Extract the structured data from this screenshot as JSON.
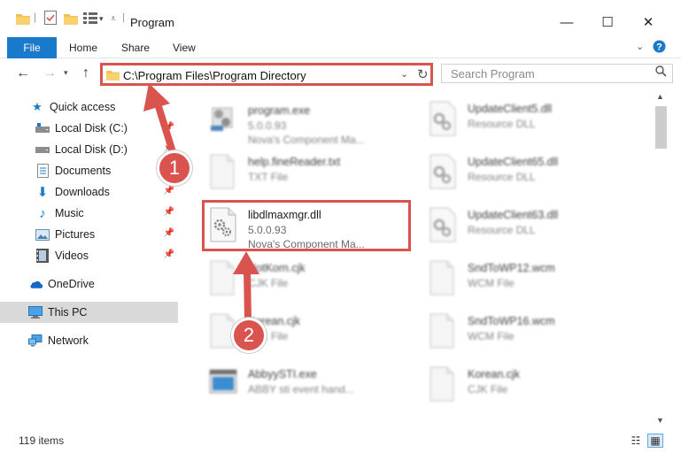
{
  "window": {
    "title": "Program",
    "controls": {
      "minimize": "—",
      "maximize": "☐",
      "close": "✕"
    }
  },
  "ribbon": {
    "tabs": [
      {
        "label": "File",
        "active": true
      },
      {
        "label": "Home"
      },
      {
        "label": "Share"
      },
      {
        "label": "View"
      }
    ],
    "collapse_icon": "chevron-down-icon",
    "help_icon": "help-icon"
  },
  "address_bar": {
    "path": "C:\\Program Files\\Program Directory",
    "search_placeholder": "Search Program"
  },
  "nav_pane": {
    "items": [
      {
        "label": "Quick access",
        "icon": "star-icon",
        "pinned": false
      },
      {
        "label": "Local Disk (C:)",
        "icon": "drive-icon",
        "pinned": true
      },
      {
        "label": "Local Disk (D:)",
        "icon": "drive-icon",
        "pinned": true
      },
      {
        "label": "Documents",
        "icon": "documents-icon",
        "pinned": true
      },
      {
        "label": "Downloads",
        "icon": "downloads-icon",
        "pinned": true
      },
      {
        "label": "Music",
        "icon": "music-icon",
        "pinned": true
      },
      {
        "label": "Pictures",
        "icon": "pictures-icon",
        "pinned": true
      },
      {
        "label": "Videos",
        "icon": "videos-icon",
        "pinned": true
      },
      {
        "label": "OneDrive",
        "icon": "onedrive-icon",
        "pinned": false
      },
      {
        "label": "This PC",
        "icon": "this-pc-icon",
        "pinned": false,
        "selected": true
      },
      {
        "label": "Network",
        "icon": "network-icon",
        "pinned": false
      }
    ]
  },
  "files": {
    "left": [
      {
        "name": "program.exe",
        "line1": "5.0.0.93",
        "line2": "Nova's Component Ma...",
        "icon": "exe-icon",
        "blurred": true
      },
      {
        "name": "help.fineReader.txt",
        "line1": "TXT File",
        "line2": "",
        "icon": "text-file-icon",
        "blurred": true
      },
      {
        "name": "libdlmaxmgr.dll",
        "line1": "5.0.0.93",
        "line2": "Nova's Component Ma...",
        "icon": "dll-icon",
        "blurred": false
      },
      {
        "name": "NotKorn.cjk",
        "line1": "CJK File",
        "line2": "",
        "icon": "generic-file-icon",
        "blurred": true
      },
      {
        "name": "Korean.cjk",
        "line1": "CJK File",
        "line2": "",
        "icon": "generic-file-icon",
        "blurred": true
      },
      {
        "name": "AbbyySTI.exe",
        "line1": "ABBY sti event hand...",
        "line2": "",
        "icon": "exe-window-icon",
        "blurred": true
      }
    ],
    "right": [
      {
        "name": "UpdateClient5.dll",
        "line1": "Resource DLL",
        "line2": "",
        "icon": "dll-icon",
        "blurred": true
      },
      {
        "name": "UpdateClient65.dll",
        "line1": "Resource DLL",
        "line2": "",
        "icon": "dll-icon",
        "blurred": true
      },
      {
        "name": "UpdateClient63.dll",
        "line1": "Resource DLL",
        "line2": "",
        "icon": "dll-icon",
        "blurred": true
      },
      {
        "name": "SndToWP12.wcm",
        "line1": "WCM File",
        "line2": "",
        "icon": "generic-file-icon",
        "blurred": true
      },
      {
        "name": "SndToWP16.wcm",
        "line1": "WCM File",
        "line2": "",
        "icon": "generic-file-icon",
        "blurred": true
      },
      {
        "name": "Korean.cjk",
        "line1": "CJK File",
        "line2": "",
        "icon": "generic-file-icon",
        "blurred": true
      }
    ]
  },
  "status": {
    "item_count": "119 items"
  },
  "annotations": {
    "callout_1": "1",
    "callout_2": "2"
  },
  "colors": {
    "accent": "#1979ca",
    "annotation": "#d9534f",
    "selected": "#d9d9d9"
  }
}
